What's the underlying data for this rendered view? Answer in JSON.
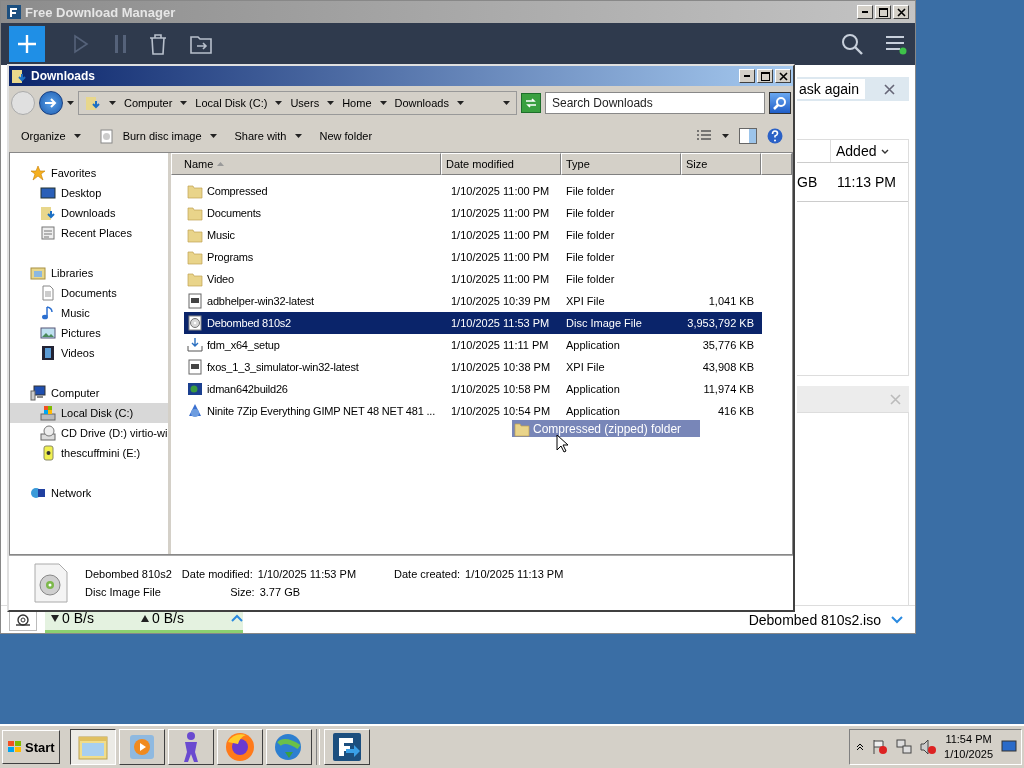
{
  "fdm": {
    "title": "Free Download Manager",
    "notice": "ask again",
    "table": {
      "columns": [
        {
          "label": "Added",
          "sorted": true
        }
      ],
      "rows": [
        {
          "size": "GB",
          "added": "11:13 PM"
        }
      ]
    },
    "status": {
      "download_speed": "0 B/s",
      "upload_speed": "0 B/s",
      "current_file": "Debombed 810s2.iso"
    }
  },
  "explorer": {
    "title": "Downloads",
    "breadcrumb": [
      "Computer",
      "Local Disk (C:)",
      "Users",
      "Home",
      "Downloads"
    ],
    "search": {
      "placeholder": "Search Downloads"
    },
    "toolbar": [
      {
        "label": "Organize",
        "menu": true,
        "kind": "plain"
      },
      {
        "label": "Burn disc image",
        "menu": true,
        "kind": "burn"
      },
      {
        "label": "Share with",
        "menu": true,
        "kind": "plain"
      },
      {
        "label": "New folder",
        "menu": false,
        "kind": "plain"
      }
    ],
    "sidebar": [
      {
        "label": "Favorites",
        "kind": "star",
        "selected": false,
        "children": [
          {
            "label": "Desktop",
            "kind": "desktop",
            "selected": false
          },
          {
            "label": "Downloads",
            "kind": "downloads",
            "selected": false
          },
          {
            "label": "Recent Places",
            "kind": "recent",
            "selected": false
          }
        ]
      },
      {
        "label": "Libraries",
        "kind": "library",
        "selected": false,
        "children": [
          {
            "label": "Documents",
            "kind": "document",
            "selected": false
          },
          {
            "label": "Music",
            "kind": "music",
            "selected": false
          },
          {
            "label": "Pictures",
            "kind": "pictures",
            "selected": false
          },
          {
            "label": "Videos",
            "kind": "videos",
            "selected": false
          }
        ]
      },
      {
        "label": "Computer",
        "kind": "computer",
        "selected": false,
        "children": [
          {
            "label": "Local Disk (C:)",
            "kind": "disk",
            "selected": true
          },
          {
            "label": "CD Drive (D:) virtio-wi",
            "kind": "cd",
            "selected": false
          },
          {
            "label": "thescuffmini (E:)",
            "kind": "usb",
            "selected": false
          }
        ]
      },
      {
        "label": "Network",
        "kind": "network",
        "selected": false
      }
    ],
    "columns": [
      {
        "label": "Name",
        "sorted": true
      },
      {
        "label": "Date modified",
        "sorted": false
      },
      {
        "label": "Type",
        "sorted": false
      },
      {
        "label": "Size",
        "sorted": false
      }
    ],
    "files": [
      {
        "name": "Compressed",
        "date": "1/10/2025 11:00 PM",
        "type": "File folder",
        "kind": "folder",
        "selected": false
      },
      {
        "name": "Documents",
        "date": "1/10/2025 11:00 PM",
        "type": "File folder",
        "kind": "folder",
        "selected": false
      },
      {
        "name": "Music",
        "date": "1/10/2025 11:00 PM",
        "type": "File folder",
        "kind": "folder",
        "selected": false
      },
      {
        "name": "Programs",
        "date": "1/10/2025 11:00 PM",
        "type": "File folder",
        "kind": "folder",
        "selected": false
      },
      {
        "name": "Video",
        "date": "1/10/2025 11:00 PM",
        "type": "File folder",
        "kind": "folder",
        "selected": false
      },
      {
        "name": "adbhelper-win32-latest",
        "date": "1/10/2025 10:39 PM",
        "type": "XPI File",
        "size": "1,041 KB",
        "kind": "xpi",
        "selected": false
      },
      {
        "name": "Debombed 810s2",
        "date": "1/10/2025 11:53 PM",
        "type": "Disc Image File",
        "size": "3,953,792 KB",
        "kind": "disc",
        "selected": true
      },
      {
        "name": "fdm_x64_setup",
        "date": "1/10/2025 11:11 PM",
        "type": "Application",
        "size": "35,776 KB",
        "kind": "setup",
        "selected": false
      },
      {
        "name": "fxos_1_3_simulator-win32-latest",
        "date": "1/10/2025 10:38 PM",
        "type": "XPI File",
        "size": "43,908 KB",
        "kind": "xpi",
        "selected": false
      },
      {
        "name": "idman642build26",
        "date": "1/10/2025 10:58 PM",
        "type": "Application",
        "size": "11,974 KB",
        "kind": "installer",
        "selected": false
      },
      {
        "name": "Ninite 7Zip Everything GIMP NET 48 NET 481 ...",
        "date": "1/10/2025 10:54 PM",
        "type": "Application",
        "size": "416 KB",
        "kind": "ninite",
        "selected": false
      }
    ],
    "details": {
      "name": "Debombed 810s2",
      "type": "Disc Image File",
      "fields": [
        {
          "label": "Date modified:",
          "value": "1/10/2025 11:53 PM"
        },
        {
          "label": "Size:",
          "value": "3.77 GB"
        },
        {
          "label": "Date created:",
          "value": "1/10/2025 11:13 PM"
        }
      ]
    }
  },
  "drag_tooltip": "Compressed (zipped) folder",
  "taskbar": {
    "start": "Start",
    "apps": [
      {
        "kind": "explorer",
        "selected": true
      },
      {
        "kind": "media",
        "selected": false
      },
      {
        "kind": "figure",
        "selected": false
      },
      {
        "kind": "firefox",
        "selected": false
      },
      {
        "kind": "idm",
        "selected": false
      },
      {
        "kind": "fdm",
        "selected": false
      }
    ],
    "clock": {
      "time": "11:54 PM",
      "date": "1/10/2025"
    }
  }
}
